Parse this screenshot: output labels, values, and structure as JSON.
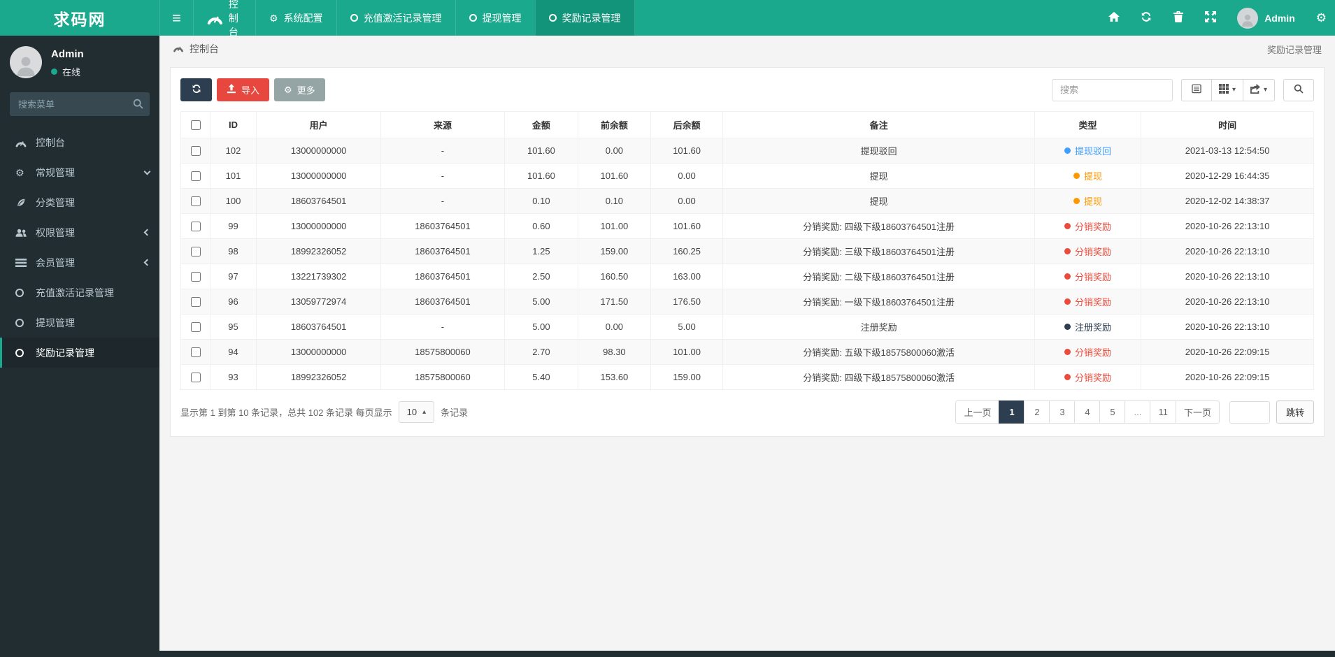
{
  "brand": {
    "logo": "求码网"
  },
  "icons": {
    "hamburger": "≡",
    "gear": "⚙",
    "cogs": "⚙",
    "caret_down": "▾",
    "caret_up": "▴"
  },
  "topbar": {
    "tabs": [
      {
        "label": "控制台",
        "icon": "dashboard",
        "active": false
      },
      {
        "label": "系统配置",
        "icon": "gear",
        "active": false
      },
      {
        "label": "充值激活记录管理",
        "icon": "circle",
        "active": false
      },
      {
        "label": "提现管理",
        "icon": "circle",
        "active": false
      },
      {
        "label": "奖励记录管理",
        "icon": "circle",
        "active": true
      }
    ],
    "user_name": "Admin"
  },
  "sidebar": {
    "user": {
      "name": "Admin",
      "status": "在线"
    },
    "search_placeholder": "搜索菜单",
    "items": [
      {
        "label": "控制台",
        "icon": "dashboard",
        "chevron": "",
        "active": false
      },
      {
        "label": "常规管理",
        "icon": "cogs",
        "chevron": "down",
        "active": false
      },
      {
        "label": "分类管理",
        "icon": "leaf",
        "chevron": "",
        "active": false
      },
      {
        "label": "权限管理",
        "icon": "users",
        "chevron": "left",
        "active": false
      },
      {
        "label": "会员管理",
        "icon": "list",
        "chevron": "left",
        "active": false
      },
      {
        "label": "充值激活记录管理",
        "icon": "circle",
        "chevron": "",
        "active": false
      },
      {
        "label": "提现管理",
        "icon": "circle",
        "chevron": "",
        "active": false
      },
      {
        "label": "奖励记录管理",
        "icon": "circle",
        "chevron": "",
        "active": true
      }
    ]
  },
  "breadcrumb": {
    "left": "控制台",
    "right": "奖励记录管理"
  },
  "toolbar": {
    "import_label": "导入",
    "more_label": "更多",
    "search_placeholder": "搜索"
  },
  "type_colors": {
    "blue": "#409eff",
    "orange": "#ff9800",
    "red": "#ec4b3c",
    "navy": "#2c3e50"
  },
  "table": {
    "columns": [
      "ID",
      "用户",
      "来源",
      "金额",
      "前余额",
      "后余额",
      "备注",
      "类型",
      "时间"
    ],
    "rows": [
      {
        "id": "102",
        "user": "13000000000",
        "source": "-",
        "amount": "101.60",
        "before": "0.00",
        "after": "101.60",
        "remark": "提现驳回",
        "type": {
          "label": "提现驳回",
          "color": "blue"
        },
        "time": "2021-03-13 12:54:50"
      },
      {
        "id": "101",
        "user": "13000000000",
        "source": "-",
        "amount": "101.60",
        "before": "101.60",
        "after": "0.00",
        "remark": "提现",
        "type": {
          "label": "提现",
          "color": "orange"
        },
        "time": "2020-12-29 16:44:35"
      },
      {
        "id": "100",
        "user": "18603764501",
        "source": "-",
        "amount": "0.10",
        "before": "0.10",
        "after": "0.00",
        "remark": "提现",
        "type": {
          "label": "提现",
          "color": "orange"
        },
        "time": "2020-12-02 14:38:37"
      },
      {
        "id": "99",
        "user": "13000000000",
        "source": "18603764501",
        "amount": "0.60",
        "before": "101.00",
        "after": "101.60",
        "remark": "分销奖励: 四级下级18603764501注册",
        "type": {
          "label": "分销奖励",
          "color": "red"
        },
        "time": "2020-10-26 22:13:10"
      },
      {
        "id": "98",
        "user": "18992326052",
        "source": "18603764501",
        "amount": "1.25",
        "before": "159.00",
        "after": "160.25",
        "remark": "分销奖励: 三级下级18603764501注册",
        "type": {
          "label": "分销奖励",
          "color": "red"
        },
        "time": "2020-10-26 22:13:10"
      },
      {
        "id": "97",
        "user": "13221739302",
        "source": "18603764501",
        "amount": "2.50",
        "before": "160.50",
        "after": "163.00",
        "remark": "分销奖励: 二级下级18603764501注册",
        "type": {
          "label": "分销奖励",
          "color": "red"
        },
        "time": "2020-10-26 22:13:10"
      },
      {
        "id": "96",
        "user": "13059772974",
        "source": "18603764501",
        "amount": "5.00",
        "before": "171.50",
        "after": "176.50",
        "remark": "分销奖励: 一级下级18603764501注册",
        "type": {
          "label": "分销奖励",
          "color": "red"
        },
        "time": "2020-10-26 22:13:10"
      },
      {
        "id": "95",
        "user": "18603764501",
        "source": "-",
        "amount": "5.00",
        "before": "0.00",
        "after": "5.00",
        "remark": "注册奖励",
        "type": {
          "label": "注册奖励",
          "color": "navy"
        },
        "time": "2020-10-26 22:13:10"
      },
      {
        "id": "94",
        "user": "13000000000",
        "source": "18575800060",
        "amount": "2.70",
        "before": "98.30",
        "after": "101.00",
        "remark": "分销奖励: 五级下级18575800060激活",
        "type": {
          "label": "分销奖励",
          "color": "red"
        },
        "time": "2020-10-26 22:09:15"
      },
      {
        "id": "93",
        "user": "18992326052",
        "source": "18575800060",
        "amount": "5.40",
        "before": "153.60",
        "after": "159.00",
        "remark": "分销奖励: 四级下级18575800060激活",
        "type": {
          "label": "分销奖励",
          "color": "red"
        },
        "time": "2020-10-26 22:09:15"
      }
    ]
  },
  "pagination": {
    "summary_prefix": "显示第 1 到第 10 条记录，总共 102 条记录 每页显示",
    "page_size": "10",
    "summary_suffix": "条记录",
    "prev": "上一页",
    "next": "下一页",
    "pages": [
      "1",
      "2",
      "3",
      "4",
      "5",
      "...",
      "11"
    ],
    "active_page": "1",
    "jump_label": "跳转"
  }
}
